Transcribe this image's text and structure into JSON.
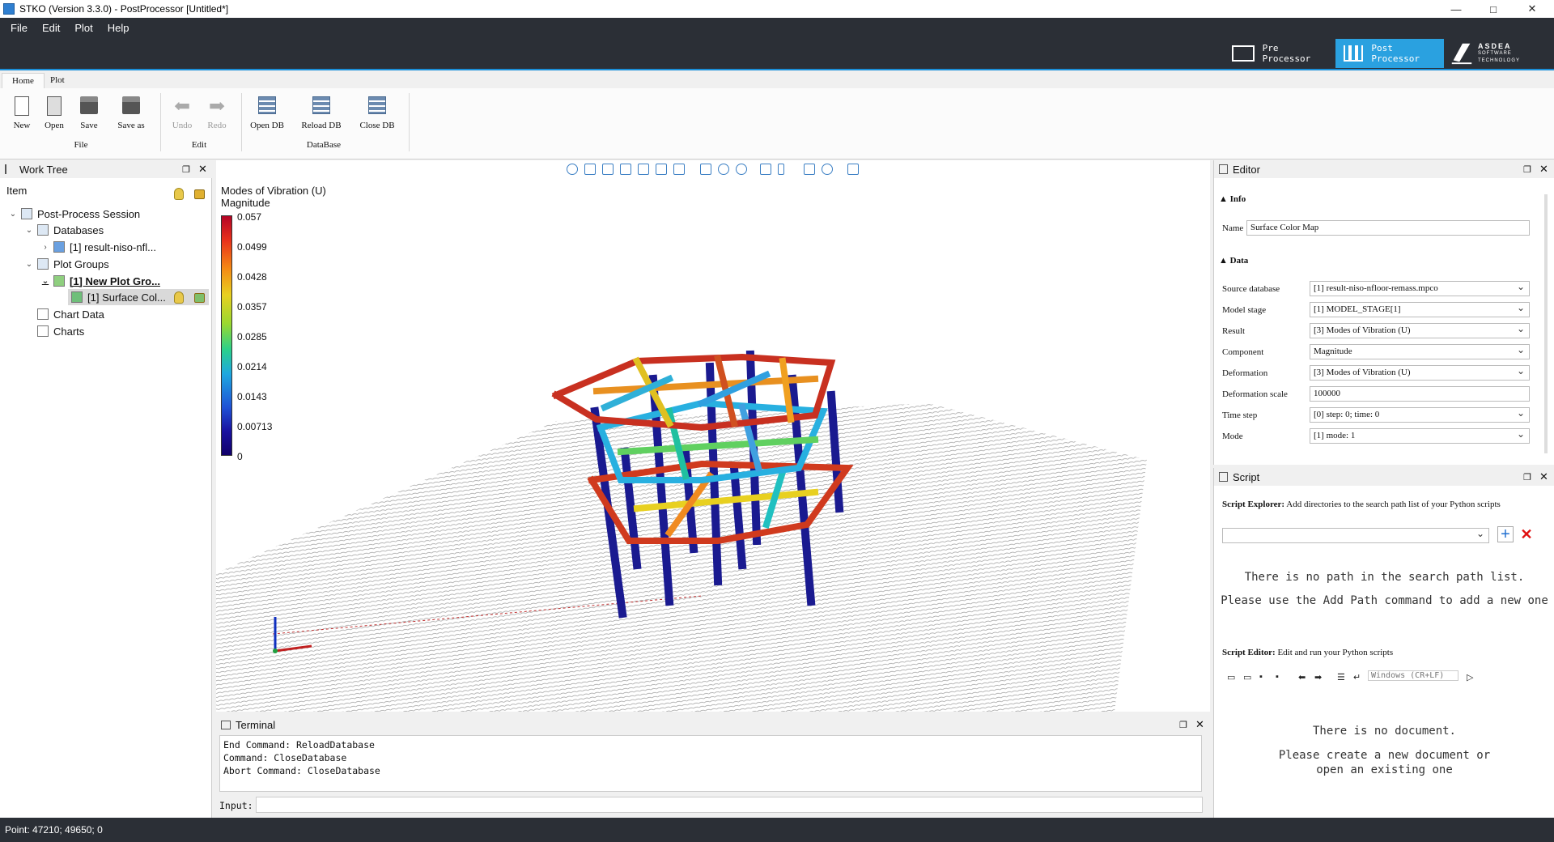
{
  "window": {
    "title": "STKO (Version 3.3.0) - PostProcessor [Untitled*]",
    "min": "—",
    "max": "□",
    "close": "✕"
  },
  "menu": [
    "File",
    "Edit",
    "Plot",
    "Help"
  ],
  "modes": {
    "pre": "Pre Processor",
    "post": "Post Processor",
    "logo_top": "ASDEA",
    "logo_bottom": "SOFTWARE TECHNOLOGY"
  },
  "ribbon": {
    "tabs": [
      "Home",
      "Plot"
    ],
    "file": {
      "new": "New",
      "open": "Open",
      "save": "Save",
      "save_as": "Save as",
      "group": "File"
    },
    "edit": {
      "undo": "Undo",
      "redo": "Redo",
      "group": "Edit"
    },
    "db": {
      "open": "Open DB",
      "reload": "Reload DB",
      "close": "Close DB",
      "group": "DataBase"
    }
  },
  "worktree": {
    "title": "Work Tree",
    "column": "Item",
    "items": [
      {
        "label": "Post-Process Session"
      },
      {
        "label": "Databases"
      },
      {
        "label": "[1] result-niso-nfl..."
      },
      {
        "label": "Plot Groups"
      },
      {
        "label": "[1] New Plot Gro..."
      },
      {
        "label": "[1] Surface Col..."
      },
      {
        "label": "Chart Data"
      },
      {
        "label": "Charts"
      }
    ]
  },
  "viewport": {
    "legend_title": "Modes of Vibration (U)",
    "legend_sub": "Magnitude",
    "ticks": [
      "0.057",
      "0.0499",
      "0.0428",
      "0.0357",
      "0.0285",
      "0.0214",
      "0.0143",
      "0.00713",
      "0"
    ]
  },
  "terminal": {
    "title": "Terminal",
    "lines": [
      "End Command: ReloadDatabase",
      "Command: CloseDatabase",
      "Abort Command: CloseDatabase"
    ],
    "input_label": "Input:"
  },
  "editor": {
    "title": "Editor",
    "info": "Info",
    "name_label": "Name",
    "name_value": "Surface Color Map",
    "data": "Data",
    "fields": [
      {
        "label": "Source database",
        "value": "[1] result-niso-nfloor-remass.mpco"
      },
      {
        "label": "Model stage",
        "value": "[1] MODEL_STAGE[1]"
      },
      {
        "label": "Result",
        "value": "[3] Modes of Vibration (U)"
      },
      {
        "label": "Component",
        "value": "Magnitude"
      },
      {
        "label": "Deformation",
        "value": "[3] Modes of Vibration (U)"
      },
      {
        "label": "Deformation scale",
        "value": "100000"
      },
      {
        "label": "Time step",
        "value": "[0] step: 0; time: 0"
      },
      {
        "label": "Mode",
        "value": "[1] mode: 1"
      }
    ]
  },
  "script": {
    "title": "Script",
    "explorer_label": "Script Explorer:",
    "explorer_desc": "Add directories to the search path list of your Python scripts",
    "msg1": "There is no path in the search path list.",
    "msg2": "Please use the Add Path command to add a new one",
    "editor_label": "Script Editor:",
    "editor_desc": "Edit and run your Python scripts",
    "eol": "Windows (CR+LF)",
    "msg3": "There is no document.",
    "msg4": "Please create a new document or open an existing one"
  },
  "status": {
    "point": "Point: 47210; 49650; 0"
  }
}
